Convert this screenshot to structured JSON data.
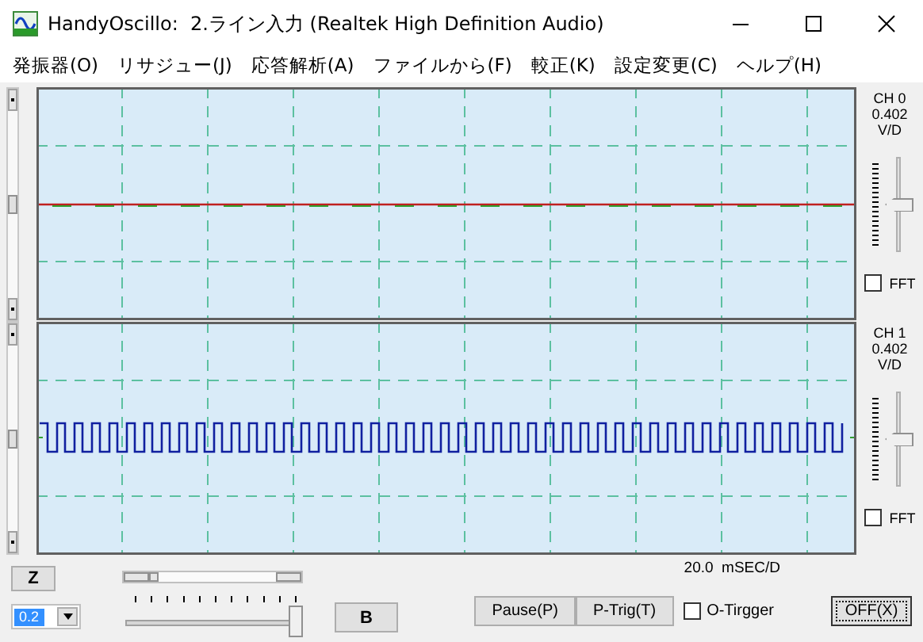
{
  "window": {
    "title": "HandyOscillo:  2.ライン入力 (Realtek High Definition Audio)"
  },
  "menu": [
    "発振器(O)",
    "リサジュー(J)",
    "応答解析(A)",
    "ファイルから(F)",
    "較正(K)",
    "設定変更(C)",
    "ヘルプ(H)"
  ],
  "channels": [
    {
      "label": "CH 0",
      "scale": "0.402",
      "unit": "V/D",
      "level": 0.5,
      "fft_label": "FFT",
      "fft_checked": false,
      "kind": "flat"
    },
    {
      "label": "CH 1",
      "scale": "0.402",
      "unit": "V/D",
      "level": 0.5,
      "fft_label": "FFT",
      "fft_checked": false,
      "kind": "square"
    }
  ],
  "zoom_button": "Z",
  "range_combo": {
    "value": "0.2"
  },
  "time_slider": {
    "level": 1
  },
  "b_button": "B",
  "timebase": "20.0  mSEC/D",
  "buttons": [
    "Pause(P)",
    "P-Trig(T)"
  ],
  "trigger": {
    "label": "O-Tirgger",
    "checked": false
  },
  "off_button": "OFF(X)"
}
